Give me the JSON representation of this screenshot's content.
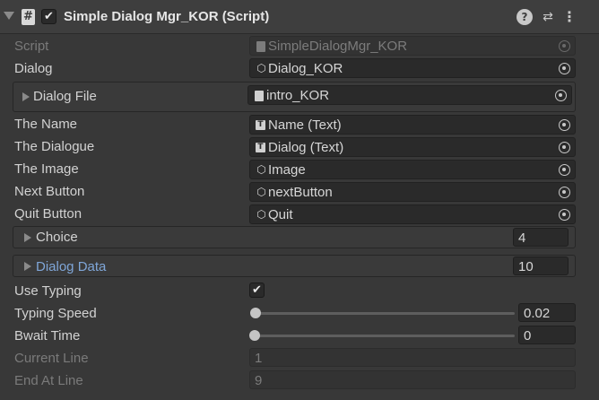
{
  "component": {
    "title": "Simple Dialog Mgr_KOR (Script)",
    "enabled": true
  },
  "fields": {
    "script": {
      "label": "Script",
      "value": "SimpleDialogMgr_KOR"
    },
    "dialog": {
      "label": "Dialog",
      "value": "Dialog_KOR"
    },
    "dialog_file": {
      "label": "Dialog File",
      "value": "intro_KOR"
    },
    "the_name": {
      "label": "The Name",
      "value": "Name (Text)"
    },
    "the_dialogue": {
      "label": "The Dialogue",
      "value": "Dialog (Text)"
    },
    "the_image": {
      "label": "The Image",
      "value": "Image"
    },
    "next_button": {
      "label": "Next Button",
      "value": "nextButton"
    },
    "quit_button": {
      "label": "Quit Button",
      "value": "Quit"
    },
    "choice": {
      "label": "Choice",
      "count": "4"
    },
    "dialog_data": {
      "label": "Dialog Data",
      "count": "10"
    },
    "use_typing": {
      "label": "Use Typing",
      "checked": true
    },
    "typing_speed": {
      "label": "Typing Speed",
      "value": "0.02",
      "slider_fraction": 0.0
    },
    "bwait_time": {
      "label": "Bwait Time",
      "value": "0",
      "slider_fraction": 0.0
    },
    "current_line": {
      "label": "Current Line",
      "value": "1"
    },
    "end_at_line": {
      "label": "End At Line",
      "value": "9"
    }
  },
  "icons": {
    "component_icon": "script-icon",
    "prefab_icon": "gameobject-icon",
    "text_component_icon": "text-icon",
    "asset_icon": "textasset-icon"
  },
  "colors": {
    "background": "#383838",
    "field": "#2a2a2a",
    "highlight_label": "#7fa6d8"
  }
}
